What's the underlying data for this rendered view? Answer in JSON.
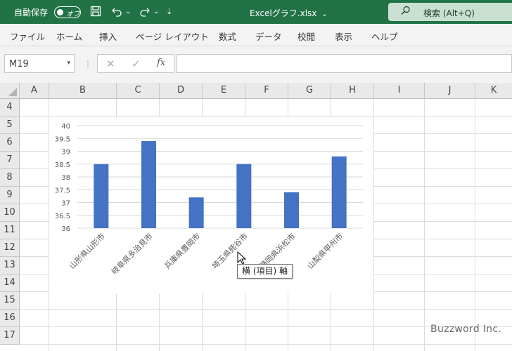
{
  "titlebar": {
    "autosave_label": "自動保存",
    "autosave_state": "オフ",
    "filename": "Excelグラフ.xlsx",
    "filename_caret": "⌄",
    "undo_caret": "⌄",
    "redo_caret": "⌄",
    "qat_more": "⇣",
    "search_text": "検索 (Alt+Q)",
    "accent": "#217346"
  },
  "ribbon": {
    "tabs": [
      "ファイル",
      "ホーム",
      "挿入",
      "ページ レイアウト",
      "数式",
      "データ",
      "校閲",
      "表示",
      "ヘルプ"
    ]
  },
  "formula_bar": {
    "name_box": "M19",
    "name_box_caret": "▾",
    "dots": "⋮",
    "cancel": "✕",
    "enter": "✓",
    "fx": "fx",
    "formula": ""
  },
  "grid": {
    "columns": [
      "A",
      "B",
      "C",
      "D",
      "E",
      "F",
      "G",
      "H",
      "I",
      "J",
      "K"
    ],
    "rows": [
      "4",
      "5",
      "6",
      "7",
      "8",
      "9",
      "10",
      "11",
      "12",
      "13",
      "14",
      "15",
      "16",
      "17"
    ]
  },
  "chart_data": {
    "type": "bar",
    "categories": [
      "山形県山形市",
      "岐阜県多治見市",
      "兵庫県豊岡市",
      "埼玉県熊谷市",
      "静岡県浜松市",
      "山梨県甲州市"
    ],
    "values": [
      38.5,
      39.4,
      37.2,
      38.5,
      37.4,
      38.8
    ],
    "ylim": [
      36,
      40
    ],
    "yticks": [
      "40",
      "39.5",
      "39",
      "38.5",
      "38",
      "37.5",
      "37",
      "36.5",
      "36"
    ],
    "grid": true,
    "bar_color": "#4472C4"
  },
  "tooltip": "横 (項目) 軸",
  "watermark": "Buzzword Inc."
}
